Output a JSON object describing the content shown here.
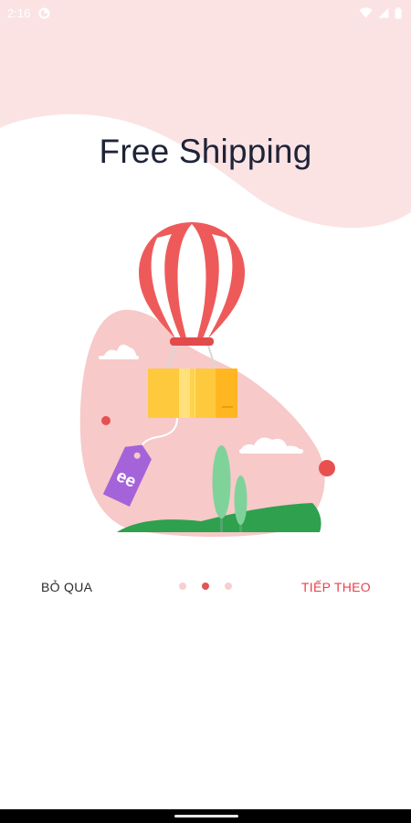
{
  "status_bar": {
    "time": "2:16",
    "icons": [
      "data-saver-icon",
      "wifi-icon",
      "cellular-signal-icon",
      "battery-icon"
    ]
  },
  "onboarding": {
    "title": "Free Shipping",
    "illustration": {
      "icons": [
        "hot-air-balloon-icon",
        "parcel-box-icon",
        "price-tag-icon",
        "cloud-icon",
        "tree-icon",
        "hill-icon"
      ],
      "tag_text": "ee"
    }
  },
  "navigation": {
    "skip_label": "BỎ QUA",
    "next_label": "TIẾP THEO",
    "page_count": 3,
    "current_page": 2
  },
  "colors": {
    "accent": "#e8414b",
    "wave": "#fbe3e4",
    "blob": "#f7c9c9",
    "balloon_red": "#ee5a5a",
    "box_yellow": "#ffc93d",
    "tag_purple": "#a563d9",
    "tree_green": "#7fd39a",
    "hill_green": "#2fa04e",
    "dot_inactive": "#f7cfd0",
    "dot_active": "#e45454",
    "title_text": "#1e2437"
  }
}
